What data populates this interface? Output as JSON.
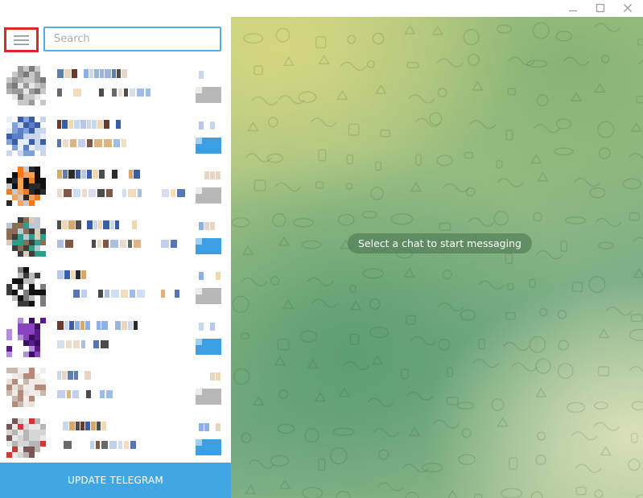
{
  "window_controls": {
    "minimize_icon": "minimize-icon",
    "maximize_icon": "maximize-icon",
    "close_icon": "close-icon"
  },
  "sidebar": {
    "menu_icon": "hamburger-menu-icon",
    "search": {
      "placeholder": "Search",
      "value": ""
    },
    "chat_count": 8,
    "update_button_label": "UPDATE TELEGRAM"
  },
  "main": {
    "empty_state_message": "Select a chat to start messaging"
  },
  "colors": {
    "accent": "#40a7e3",
    "search_border": "#4eaee8",
    "menu_highlight": "#e02626"
  }
}
